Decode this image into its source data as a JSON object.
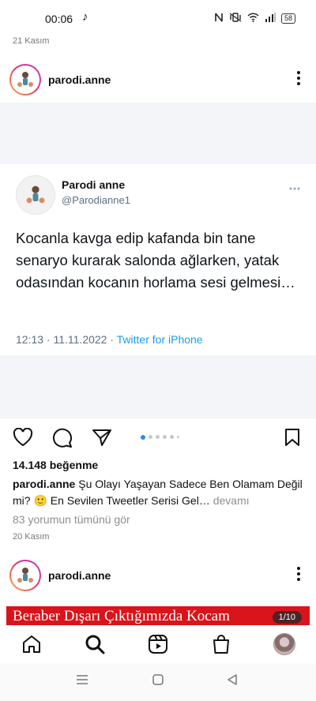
{
  "status": {
    "time": "00:06",
    "music_icon": "♪",
    "battery": "58"
  },
  "feed": {
    "date_top": "21 Kasım",
    "post1": {
      "username": "parodi.anne",
      "tweet": {
        "display_name": "Parodi anne",
        "handle": "@Parodianne1",
        "text": "Kocanla kavga edip kafanda bin tane senaryo kurarak salonda ağlarken, yatak odasından kocanın horlama sesi gelmesi…",
        "time_date": "12:13 · 11.11.2022 · ",
        "source": "Twitter for iPhone"
      },
      "likes": "14.148 beğenme",
      "caption_user": "parodi.anne",
      "caption_text": " Şu Olayı Yaşayan Sadece Ben Olamam Değil mi? 🙂 En Sevilen Tweetler Serisi Gel…",
      "caption_more": " devamı",
      "comments": "83 yorumun tümünü gör",
      "date": "20 Kasım",
      "carousel": {
        "pages": 6,
        "active": 0
      }
    },
    "post2": {
      "username": "parodi.anne",
      "banner_text": "Beraber Dışarı Çıktığımızda Kocam",
      "counter": "1/10"
    }
  },
  "icons": {
    "like": "heart-icon",
    "comment": "comment-icon",
    "share": "send-icon",
    "save": "bookmark-icon",
    "home": "home-icon",
    "search": "search-icon",
    "reels": "reels-icon",
    "shop": "shop-icon"
  },
  "colors": {
    "link": "#1d9bf0",
    "carousel_active": "#2c8cf0",
    "banner": "#d9141b"
  }
}
